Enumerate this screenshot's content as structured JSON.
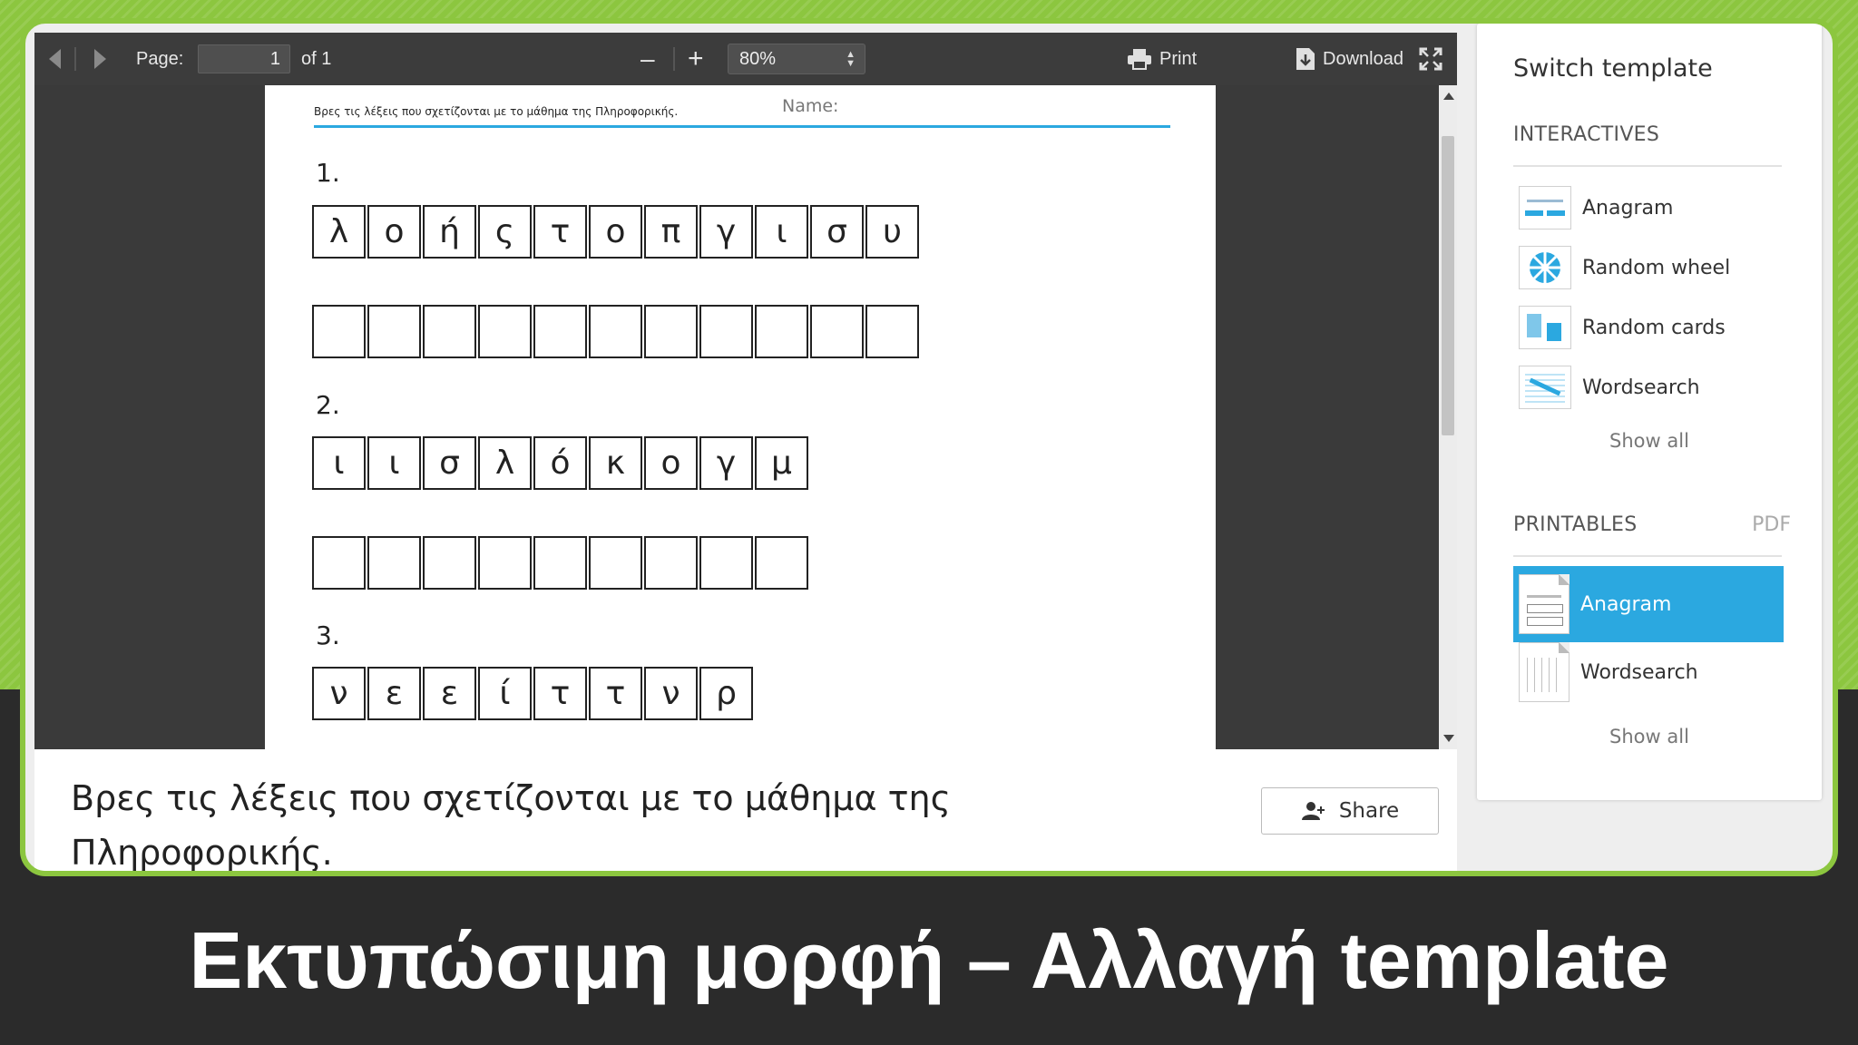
{
  "toolbar": {
    "page_label": "Page:",
    "page_value": "1",
    "page_of": "of 1",
    "zoom_out": "–",
    "zoom_in": "+",
    "zoom_value": "80%",
    "print_label": "Print",
    "download_label": "Download"
  },
  "worksheet": {
    "header_text": "Βρες τις λέξεις που σχετίζονται με το μάθημα της Πληροφορικής.",
    "name_label": "Name:",
    "questions": [
      {
        "number": "1.",
        "letters": [
          "λ",
          "ο",
          "ή",
          "ς",
          "τ",
          "ο",
          "π",
          "γ",
          "ι",
          "σ",
          "υ"
        ]
      },
      {
        "number": "2.",
        "letters": [
          "ι",
          "ι",
          "σ",
          "λ",
          "ό",
          "κ",
          "ο",
          "γ",
          "μ"
        ]
      },
      {
        "number": "3.",
        "letters": [
          "ν",
          "ε",
          "ε",
          "ί",
          "τ",
          "τ",
          "ν",
          "ρ"
        ]
      }
    ]
  },
  "description": {
    "line1": "Βρες τις λέξεις που σχετίζονται με το μάθημα της",
    "line2": "Πληροφορικής.",
    "share_label": "Share"
  },
  "panel": {
    "title": "Switch template",
    "interactives_label": "INTERACTIVES",
    "interactives": [
      {
        "label": "Anagram",
        "icon": "anagram-thumb"
      },
      {
        "label": "Random wheel",
        "icon": "wheel-thumb"
      },
      {
        "label": "Random cards",
        "icon": "cards-thumb"
      },
      {
        "label": "Wordsearch",
        "icon": "wordsearch-thumb"
      }
    ],
    "show_all": "Show all",
    "printables_label": "PRINTABLES",
    "pdf_label": "PDF",
    "printables": [
      {
        "label": "Anagram",
        "selected": true
      },
      {
        "label": "Wordsearch",
        "selected": false
      }
    ],
    "show_all_2": "Show all"
  },
  "caption": "Εκτυπώσιμη μορφή – Αλλαγή template",
  "colors": {
    "accent": "#2ba8e0",
    "frame_green": "#8cc63f",
    "dark": "#2b2b2b"
  }
}
